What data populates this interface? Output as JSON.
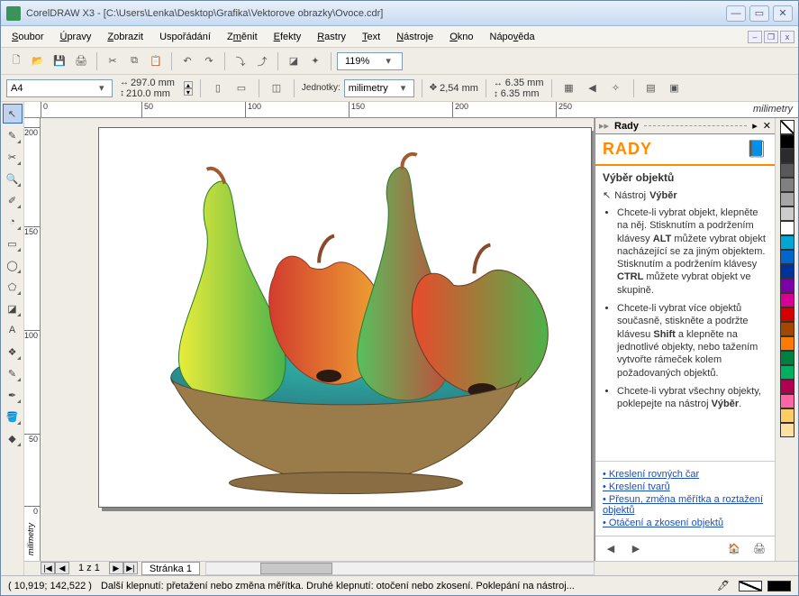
{
  "app": {
    "title": "CorelDRAW X3 - [C:\\Users\\Lenka\\Desktop\\Grafika\\Vektorove obrazky\\Ovoce.cdr]"
  },
  "menu": {
    "items": [
      "Soubor",
      "Úpravy",
      "Zobrazit",
      "Uspořádání",
      "Změnit",
      "Efekty",
      "Rastry",
      "Text",
      "Nástroje",
      "Okno",
      "Nápověda"
    ]
  },
  "toolbar": {
    "zoom": "119%"
  },
  "propbar": {
    "paper": "A4",
    "width": "297.0 mm",
    "height": "210.0 mm",
    "units_label": "Jednotky:",
    "units": "milimetry",
    "nudge": "2,54 mm",
    "dupx": "6.35 mm",
    "dupy": "6.35 mm"
  },
  "ruler": {
    "unit": "milimetry",
    "hticks": [
      "0",
      "50",
      "100",
      "150",
      "200",
      "250"
    ],
    "vticks": [
      "200",
      "150",
      "100",
      "50",
      "0"
    ]
  },
  "pages": {
    "counter": "1 z 1",
    "tab": "Stránka 1"
  },
  "rady": {
    "panel_label": "Rady",
    "title": "RADY",
    "subtitle": "Výběr objektů",
    "tool_label": "Nástroj",
    "tool_name": "Výběr",
    "bullets": [
      "Chcete-li vybrat objekt, klepněte na něj. Stisknutím a podržením klávesy <b>ALT</b> můžete vybrat objekt nacházející se za jiným objektem. Stisknutím a podržením klávesy <b>CTRL</b> můžete vybrat objekt ve skupině.",
      "Chcete-li vybrat více objektů současně, stiskněte a podržte klávesu <b>Shift</b> a klepněte na jednotlivé objekty, nebo tažením vytvořte rámeček kolem požadovaných objektů.",
      "Chcete-li vybrat všechny objekty, poklepejte na nástroj <b>Výběr</b>."
    ],
    "links": [
      "Kreslení rovných čar",
      "Kreslení tvarů",
      "Přesun, změna měřítka a roztažení objektů",
      "Otáčení a zkosení objektů"
    ]
  },
  "swatches": [
    "none",
    "#000000",
    "#2b2b2b",
    "#595959",
    "#808080",
    "#a6a6a6",
    "#cccccc",
    "#ffffff",
    "#00a7d4",
    "#0066cc",
    "#003399",
    "#7b00a8",
    "#d60093",
    "#d40000",
    "#a34700",
    "#ff7a00",
    "#008040",
    "#00b060",
    "#b00050",
    "#ff66a3",
    "#ffcc66",
    "#ffe0a3"
  ],
  "status": {
    "coords": "( 10,919; 142,522 )",
    "hint": "Další klepnutí: přetažení nebo změna měřítka. Druhé klepnutí: otočení nebo zkosení. Poklepání na nástroj..."
  }
}
